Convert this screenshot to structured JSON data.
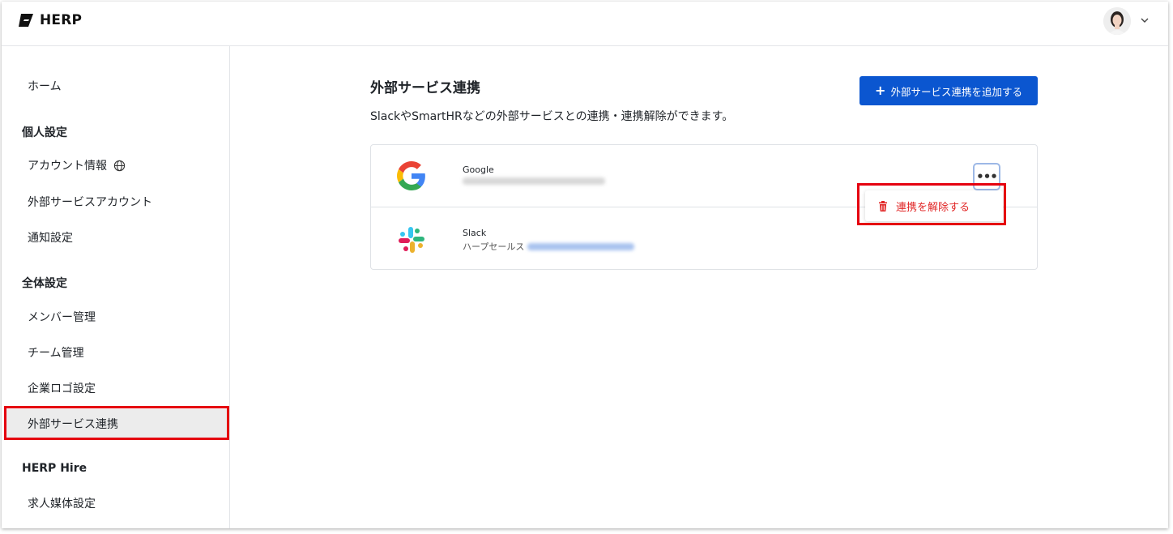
{
  "header": {
    "logo_text": "HERP"
  },
  "sidebar": {
    "home": "ホーム",
    "personal_section": "個人設定",
    "personal_items": [
      "アカウント情報",
      "外部サービスアカウント",
      "通知設定"
    ],
    "global_section": "全体設定",
    "global_items": [
      "メンバー管理",
      "チーム管理",
      "企業ロゴ設定",
      "外部サービス連携"
    ],
    "hire_section": "HERP Hire",
    "hire_items": [
      "求人媒体設定"
    ],
    "active_item": "外部サービス連携"
  },
  "main": {
    "title": "外部サービス連携",
    "description": "SlackやSmartHRなどの外部サービスとの連携・連携解除ができます。",
    "add_button_label": "外部サービス連携を追加する",
    "services": [
      {
        "name": "Google",
        "icon": "google-logo-icon"
      },
      {
        "name": "Slack",
        "workspace": "ハープセールス",
        "icon": "slack-logo-icon"
      }
    ],
    "menu": {
      "unlink_label": "連携を解除する"
    }
  },
  "icons": [
    "globe-icon",
    "chevron-down-icon",
    "plus-icon",
    "more-icon",
    "trash-icon"
  ],
  "colors": {
    "primary": "#0b56d0",
    "danger": "#e12626",
    "highlight": "#e5000f",
    "active_bg": "#ececec"
  }
}
